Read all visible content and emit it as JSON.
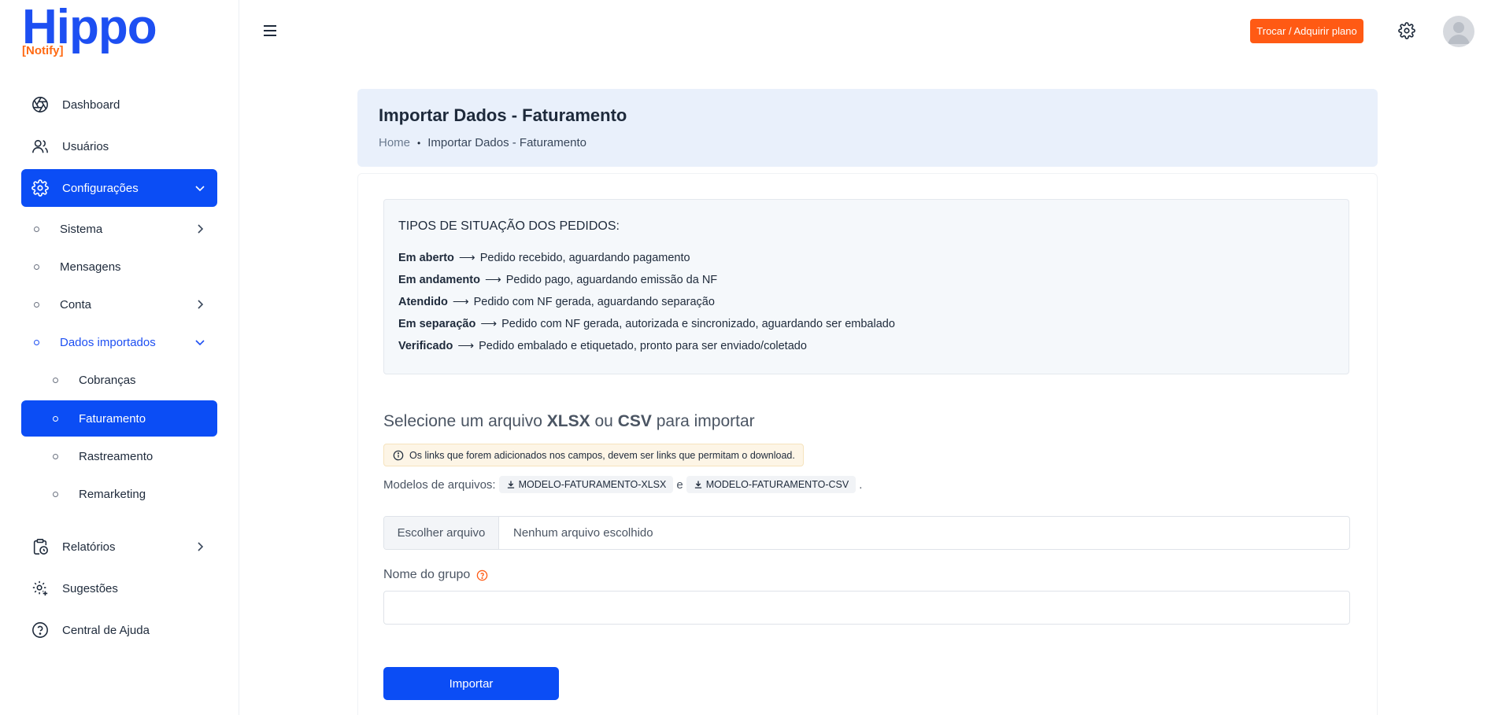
{
  "brand": {
    "name": "Hippo",
    "sub": "[Notify]",
    "colors": {
      "primary": "#0b4df5",
      "accent": "#ff5a14"
    }
  },
  "sidebar": {
    "items": [
      {
        "label": "Dashboard",
        "icon": "aperture-icon"
      },
      {
        "label": "Usuários",
        "icon": "users-icon"
      },
      {
        "label": "Configurações",
        "icon": "gear-icon",
        "active": true
      },
      {
        "label": "Relatórios",
        "icon": "clipboard-clock-icon"
      },
      {
        "label": "Sugestões",
        "icon": "gear-plus-icon"
      },
      {
        "label": "Central de Ajuda",
        "icon": "help-circle-icon"
      }
    ],
    "config_sub": [
      {
        "label": "Sistema"
      },
      {
        "label": "Mensagens"
      },
      {
        "label": "Conta"
      },
      {
        "label": "Dados importados"
      }
    ],
    "dados_sub": [
      {
        "label": "Cobranças"
      },
      {
        "label": "Faturamento",
        "active": true
      },
      {
        "label": "Rastreamento"
      },
      {
        "label": "Remarketing"
      }
    ]
  },
  "topbar": {
    "plan_button": "Trocar / Adquirir plano"
  },
  "header": {
    "title": "Importar Dados - Faturamento",
    "breadcrumb_home": "Home",
    "breadcrumb_sep": "•",
    "breadcrumb_current": "Importar Dados - Faturamento"
  },
  "status_info": {
    "heading": "TIPOS DE SITUAÇÃO DOS PEDIDOS:",
    "arrow": "⟶",
    "lines": [
      {
        "term": "Em aberto",
        "desc": "Pedido recebido, aguardando pagamento"
      },
      {
        "term": "Em andamento",
        "desc": "Pedido pago, aguardando emissão da NF"
      },
      {
        "term": "Atendido",
        "desc": "Pedido com NF gerada, aguardando separação"
      },
      {
        "term": "Em separação",
        "desc": "Pedido com NF gerada, autorizada e sincronizado, aguardando ser embalado"
      },
      {
        "term": "Verificado",
        "desc": "Pedido embalado e etiquetado, pronto para ser enviado/coletado"
      }
    ]
  },
  "import_form": {
    "title_prefix": "Selecione um arquivo",
    "title_xlsx": "XLSX",
    "title_or": "ou",
    "title_csv": "CSV",
    "title_suffix": "para importar",
    "notice": "Os links que forem adicionados nos campos, devem ser links que permitam o download.",
    "models_label": "Modelos de arquivos:",
    "model_xlsx": "MODELO-FATURAMENTO-XLSX",
    "models_and": "e",
    "model_csv": "MODELO-FATURAMENTO-CSV",
    "models_end": ".",
    "file_button": "Escolher arquivo",
    "file_status": "Nenhum arquivo escolhido",
    "group_label": "Nome do grupo",
    "group_value": "",
    "submit": "Importar"
  }
}
